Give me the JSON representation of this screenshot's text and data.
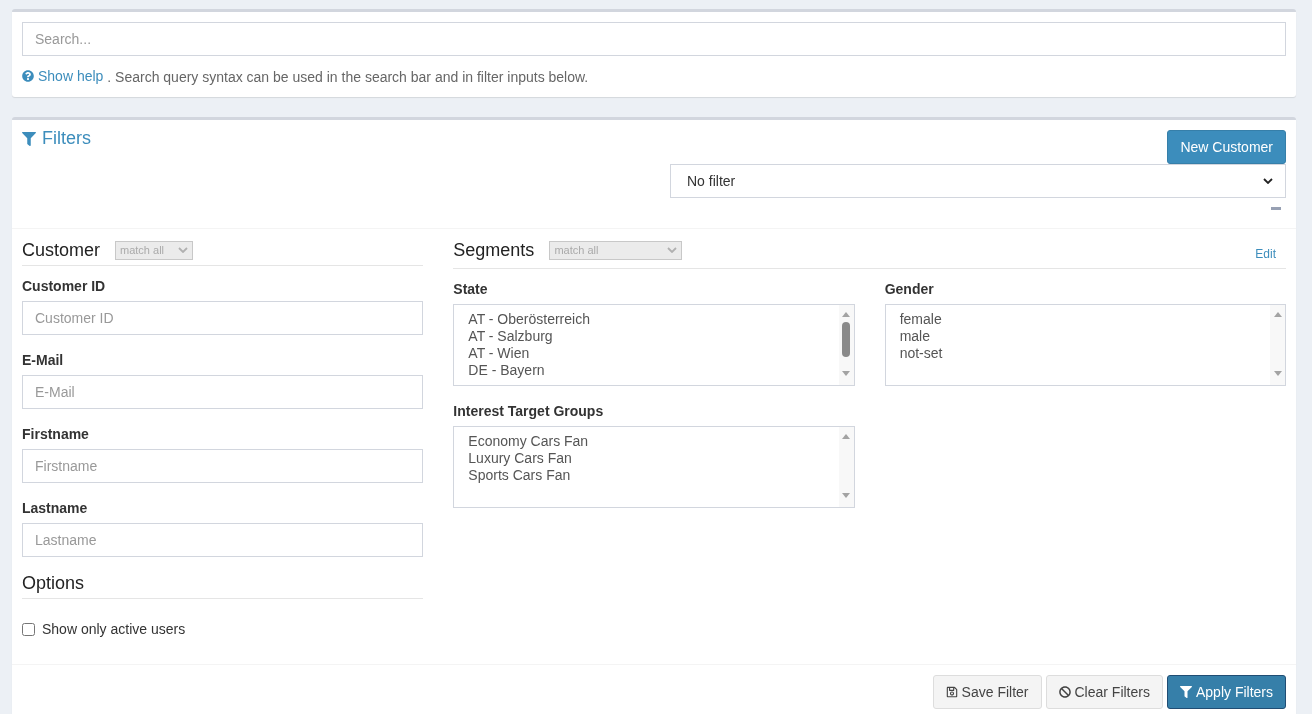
{
  "search": {
    "placeholder": "Search..."
  },
  "help": {
    "link": "Show help",
    "text": ". Search query syntax can be used in the search bar and in filter inputs below."
  },
  "filters": {
    "title": "Filters",
    "new_button": "New Customer",
    "preset": {
      "value": "No filter"
    }
  },
  "customer": {
    "title": "Customer",
    "match": {
      "value": "match all",
      "disabled": true
    },
    "fields": [
      {
        "label": "Customer ID",
        "placeholder": "Customer ID"
      },
      {
        "label": "E-Mail",
        "placeholder": "E-Mail"
      },
      {
        "label": "Firstname",
        "placeholder": "Firstname"
      },
      {
        "label": "Lastname",
        "placeholder": "Lastname"
      }
    ]
  },
  "options": {
    "title": "Options",
    "checkboxes": [
      {
        "label": "Show only active users",
        "checked": false
      }
    ]
  },
  "segments": {
    "title": "Segments",
    "match": {
      "value": "match all",
      "disabled": true
    },
    "edit": "Edit",
    "groups": [
      {
        "label": "State",
        "scrollable": true,
        "items": [
          {
            "text": "AT - Oberösterreich",
            "selected": false
          },
          {
            "text": "AT - Salzburg",
            "selected": false
          },
          {
            "text": "AT - Wien",
            "selected": false
          },
          {
            "text": "DE - Bayern",
            "selected": false
          }
        ]
      },
      {
        "label": "Gender",
        "scrollable": false,
        "items": [
          {
            "text": "female",
            "selected": false
          },
          {
            "text": "male",
            "selected": false
          },
          {
            "text": "not-set",
            "selected": false
          }
        ]
      },
      {
        "label": "Interest Target Groups",
        "scrollable": false,
        "items": [
          {
            "text": "Economy Cars Fan",
            "selected": false
          },
          {
            "text": "Luxury Cars Fan",
            "selected": false
          },
          {
            "text": "Sports Cars Fan",
            "selected": false
          }
        ]
      }
    ]
  },
  "buttons": [
    {
      "label": "Save Filter",
      "kind": "save"
    },
    {
      "label": "Clear Filters",
      "kind": "clear"
    },
    {
      "label": "Apply Filters",
      "kind": "apply"
    }
  ]
}
